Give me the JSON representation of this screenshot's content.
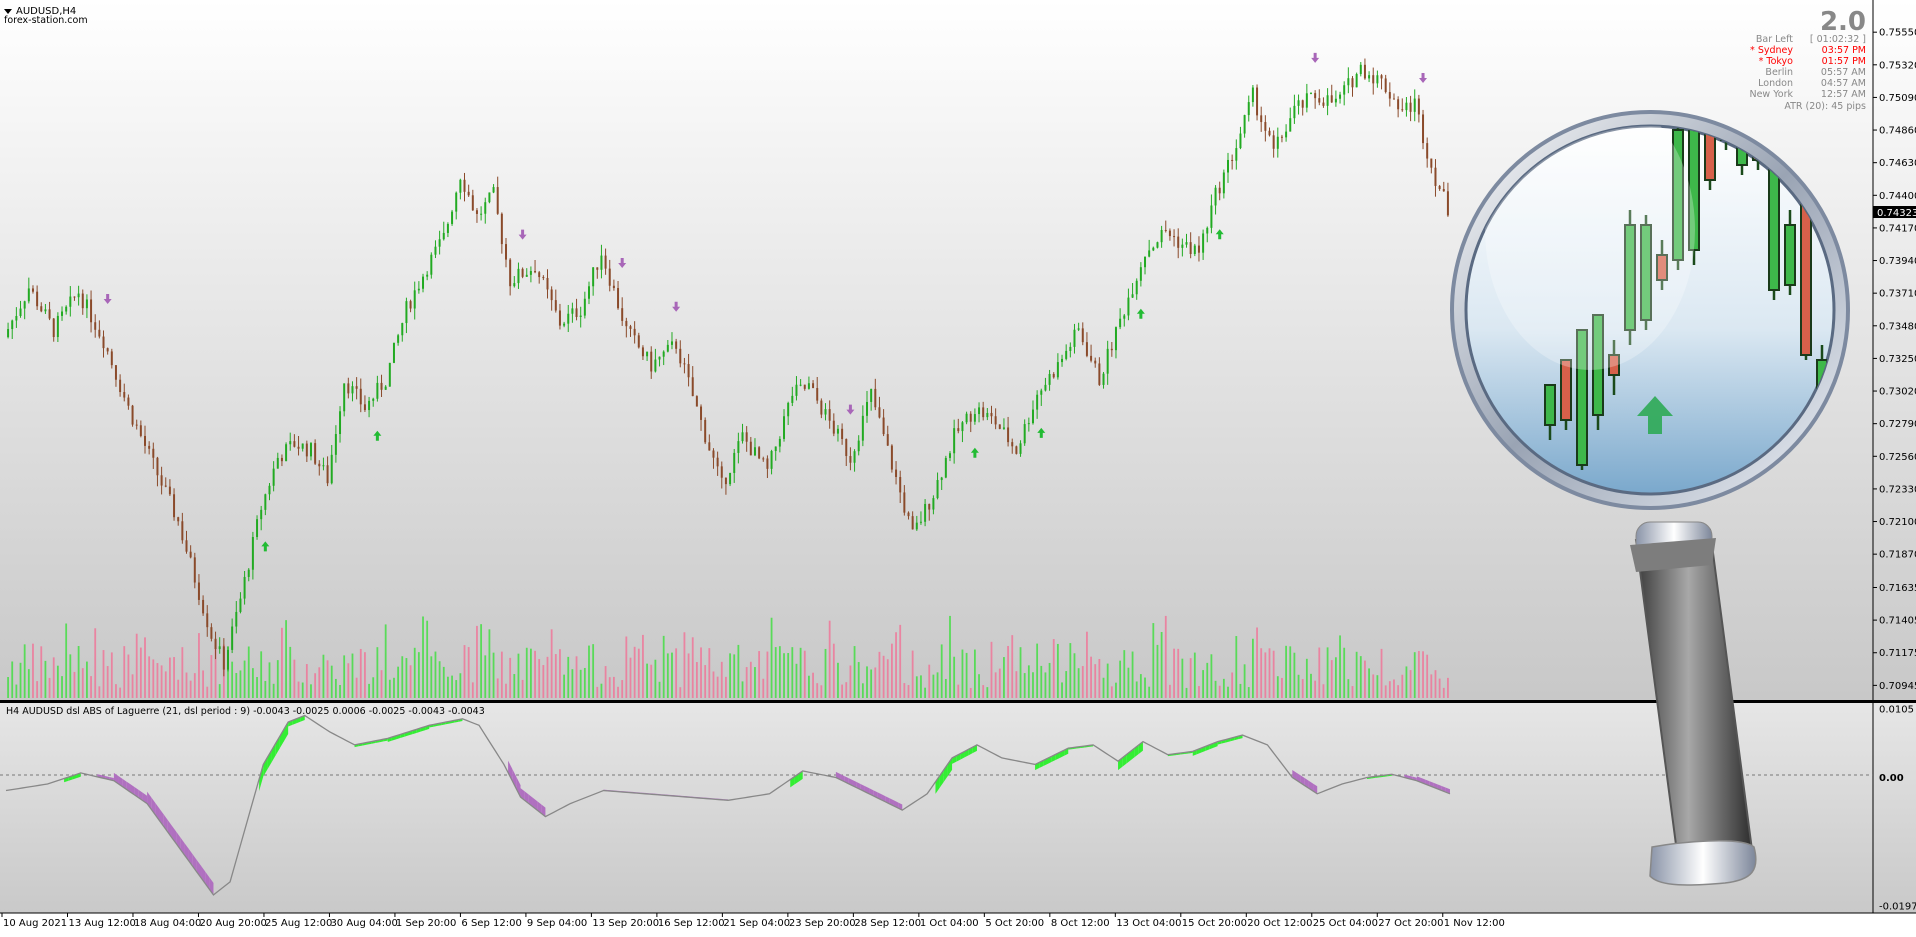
{
  "window": {
    "title": "AUDUSD,H4",
    "watermark": "forex-station.com",
    "version": "2.0"
  },
  "info_panel": {
    "rows": [
      {
        "label": "Bar Left",
        "value": "[ 01:02:32 ]",
        "highlight": false
      },
      {
        "label": "* Sydney",
        "value": "03:57 PM",
        "highlight": true
      },
      {
        "label": "* Tokyo",
        "value": "01:57 PM",
        "highlight": true
      },
      {
        "label": "Berlin",
        "value": "05:57 AM",
        "highlight": false
      },
      {
        "label": "London",
        "value": "04:57 AM",
        "highlight": false
      },
      {
        "label": "New York",
        "value": "12:57 AM",
        "highlight": false
      }
    ],
    "atr": "ATR (20): 45 pips"
  },
  "indicator": {
    "caption": "H4 AUDUSD  dsl ABS of Laguerre (21, dsl period : 9) -0.0043 -0.0025 0.0006 -0.0025 -0.0043 -0.0043"
  },
  "colors": {
    "bull": "#22aa22",
    "bear": "#8a4a2a",
    "volume_up": "#44dd44",
    "volume_down": "#ee7799",
    "arrow_up": "#22bb33",
    "arrow_down": "#a866b8",
    "osc_up": "#33ee33",
    "osc_down": "#b070c0",
    "osc_line": "#888888",
    "session_on": "#ff0000",
    "session_off": "#888888"
  },
  "chart_data": {
    "type": "candlestick",
    "symbol": "AUDUSD",
    "timeframe": "H4",
    "price_axis": {
      "ticks": [
        "0.75550",
        "0.75320",
        "0.75090",
        "0.74860",
        "0.74630",
        "0.74400",
        "0.74170",
        "0.73940",
        "0.73710",
        "0.73480",
        "0.73250",
        "0.73020",
        "0.72790",
        "0.72560",
        "0.72330",
        "0.72100",
        "0.71870",
        "0.71635",
        "0.71405",
        "0.71175",
        "0.70945"
      ],
      "range": [
        0.7087,
        0.7565
      ],
      "current_price": "0.74323"
    },
    "time_axis": [
      "10 Aug 2021",
      "13 Aug 12:00",
      "18 Aug 04:00",
      "20 Aug 20:00",
      "25 Aug 12:00",
      "30 Aug 04:00",
      "1 Sep 20:00",
      "6 Sep 12:00",
      "9 Sep 04:00",
      "13 Sep 20:00",
      "16 Sep 12:00",
      "21 Sep 04:00",
      "23 Sep 20:00",
      "28 Sep 12:00",
      "1 Oct 04:00",
      "5 Oct 20:00",
      "8 Oct 12:00",
      "13 Oct 04:00",
      "15 Oct 20:00",
      "20 Oct 12:00",
      "25 Oct 04:00",
      "27 Oct 20:00",
      "1 Nov 12:00"
    ],
    "price_path": [
      [
        0,
        0.734
      ],
      [
        6,
        0.7375
      ],
      [
        12,
        0.7345
      ],
      [
        18,
        0.7372
      ],
      [
        24,
        0.7338
      ],
      [
        30,
        0.729
      ],
      [
        36,
        0.725
      ],
      [
        42,
        0.721
      ],
      [
        46,
        0.717
      ],
      [
        50,
        0.713
      ],
      [
        53,
        0.711
      ],
      [
        57,
        0.7155
      ],
      [
        62,
        0.722
      ],
      [
        66,
        0.7255
      ],
      [
        70,
        0.7265
      ],
      [
        74,
        0.726
      ],
      [
        78,
        0.724
      ],
      [
        82,
        0.731
      ],
      [
        87,
        0.729
      ],
      [
        92,
        0.731
      ],
      [
        97,
        0.736
      ],
      [
        102,
        0.739
      ],
      [
        106,
        0.741
      ],
      [
        110,
        0.7455
      ],
      [
        114,
        0.7425
      ],
      [
        118,
        0.744
      ],
      [
        122,
        0.738
      ],
      [
        128,
        0.739
      ],
      [
        134,
        0.735
      ],
      [
        139,
        0.736
      ],
      [
        144,
        0.74
      ],
      [
        150,
        0.7345
      ],
      [
        156,
        0.732
      ],
      [
        162,
        0.7335
      ],
      [
        168,
        0.728
      ],
      [
        173,
        0.7235
      ],
      [
        178,
        0.727
      ],
      [
        184,
        0.7245
      ],
      [
        190,
        0.73
      ],
      [
        194,
        0.7305
      ],
      [
        199,
        0.728
      ],
      [
        204,
        0.7255
      ],
      [
        209,
        0.73
      ],
      [
        214,
        0.725
      ],
      [
        219,
        0.72
      ],
      [
        224,
        0.723
      ],
      [
        229,
        0.727
      ],
      [
        234,
        0.729
      ],
      [
        239,
        0.728
      ],
      [
        244,
        0.726
      ],
      [
        249,
        0.73
      ],
      [
        254,
        0.732
      ],
      [
        259,
        0.7345
      ],
      [
        264,
        0.731
      ],
      [
        270,
        0.736
      ],
      [
        275,
        0.74
      ],
      [
        280,
        0.7415
      ],
      [
        284,
        0.7405
      ],
      [
        288,
        0.74
      ],
      [
        292,
        0.744
      ],
      [
        297,
        0.7475
      ],
      [
        301,
        0.751
      ],
      [
        306,
        0.747
      ],
      [
        311,
        0.75
      ],
      [
        316,
        0.751
      ],
      [
        321,
        0.7505
      ],
      [
        327,
        0.753
      ],
      [
        332,
        0.752
      ],
      [
        337,
        0.75
      ],
      [
        340,
        0.7505
      ],
      [
        344,
        0.746
      ],
      [
        348,
        0.743
      ]
    ],
    "candles_total": 348,
    "volume_pattern": "alternating green (up) and pink (down) bars under price",
    "signal_arrows": [
      {
        "dir": "down",
        "at": 24
      },
      {
        "dir": "up",
        "at": 62
      },
      {
        "dir": "up",
        "at": 89
      },
      {
        "dir": "down",
        "at": 124
      },
      {
        "dir": "down",
        "at": 148
      },
      {
        "dir": "down",
        "at": 161
      },
      {
        "dir": "down",
        "at": 203
      },
      {
        "dir": "up",
        "at": 233
      },
      {
        "dir": "up",
        "at": 249
      },
      {
        "dir": "up",
        "at": 273
      },
      {
        "dir": "up",
        "at": 292
      },
      {
        "dir": "down",
        "at": 315
      },
      {
        "dir": "down",
        "at": 341
      }
    ],
    "indicator_axis": {
      "ticks": [
        "0.0105",
        "0.00",
        "-0.0197"
      ],
      "range": [
        -0.0197,
        0.0105
      ]
    },
    "oscillator_path": [
      [
        0,
        -0.002
      ],
      [
        10,
        -0.001
      ],
      [
        18,
        0.0007
      ],
      [
        26,
        -0.0005
      ],
      [
        34,
        -0.004
      ],
      [
        42,
        -0.011
      ],
      [
        50,
        -0.018
      ],
      [
        54,
        -0.016
      ],
      [
        58,
        -0.007
      ],
      [
        62,
        0.002
      ],
      [
        68,
        0.0085
      ],
      [
        72,
        0.0095
      ],
      [
        78,
        0.007
      ],
      [
        84,
        0.005
      ],
      [
        92,
        0.006
      ],
      [
        102,
        0.008
      ],
      [
        110,
        0.009
      ],
      [
        114,
        0.008
      ],
      [
        120,
        0.002
      ],
      [
        124,
        -0.003
      ],
      [
        130,
        -0.006
      ],
      [
        136,
        -0.004
      ],
      [
        144,
        -0.002
      ],
      [
        154,
        -0.0025
      ],
      [
        164,
        -0.003
      ],
      [
        174,
        -0.0035
      ],
      [
        184,
        -0.0025
      ],
      [
        192,
        0.001
      ],
      [
        200,
        0.0
      ],
      [
        208,
        -0.0025
      ],
      [
        216,
        -0.005
      ],
      [
        222,
        -0.0025
      ],
      [
        228,
        0.003
      ],
      [
        234,
        0.005
      ],
      [
        240,
        0.003
      ],
      [
        248,
        0.002
      ],
      [
        256,
        0.0045
      ],
      [
        262,
        0.005
      ],
      [
        268,
        0.0025
      ],
      [
        274,
        0.0055
      ],
      [
        280,
        0.0035
      ],
      [
        286,
        0.004
      ],
      [
        292,
        0.0055
      ],
      [
        298,
        0.0065
      ],
      [
        304,
        0.005
      ],
      [
        310,
        0.0
      ],
      [
        316,
        -0.0025
      ],
      [
        322,
        -0.001
      ],
      [
        328,
        0.0
      ],
      [
        334,
        0.0005
      ],
      [
        340,
        -0.0005
      ],
      [
        348,
        -0.0025
      ]
    ]
  }
}
